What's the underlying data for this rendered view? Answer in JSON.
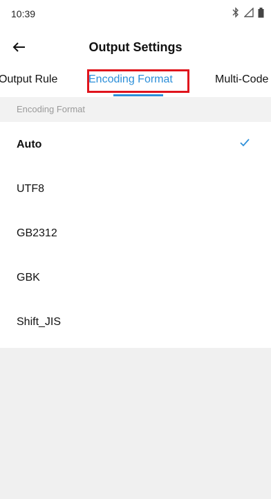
{
  "status_bar": {
    "time": "10:39",
    "icons": [
      "bluetooth-icon",
      "signal-icon",
      "battery-icon"
    ]
  },
  "header": {
    "title": "Output Settings",
    "back_icon": "arrow-left-icon"
  },
  "tabs": [
    {
      "label": "Output Rule",
      "selected": false
    },
    {
      "label": "Encoding Format",
      "selected": true
    },
    {
      "label": "Multi-Code",
      "selected": false
    }
  ],
  "section": {
    "header": "Encoding Format"
  },
  "options": [
    {
      "label": "Auto",
      "selected": true
    },
    {
      "label": "UTF8",
      "selected": false
    },
    {
      "label": "GB2312",
      "selected": false
    },
    {
      "label": "GBK",
      "selected": false
    },
    {
      "label": "Shift_JIS",
      "selected": false
    }
  ],
  "colors": {
    "accent": "#2c8fd9",
    "highlight_box": "#e0141c",
    "section_bg": "#f2f2f2"
  }
}
